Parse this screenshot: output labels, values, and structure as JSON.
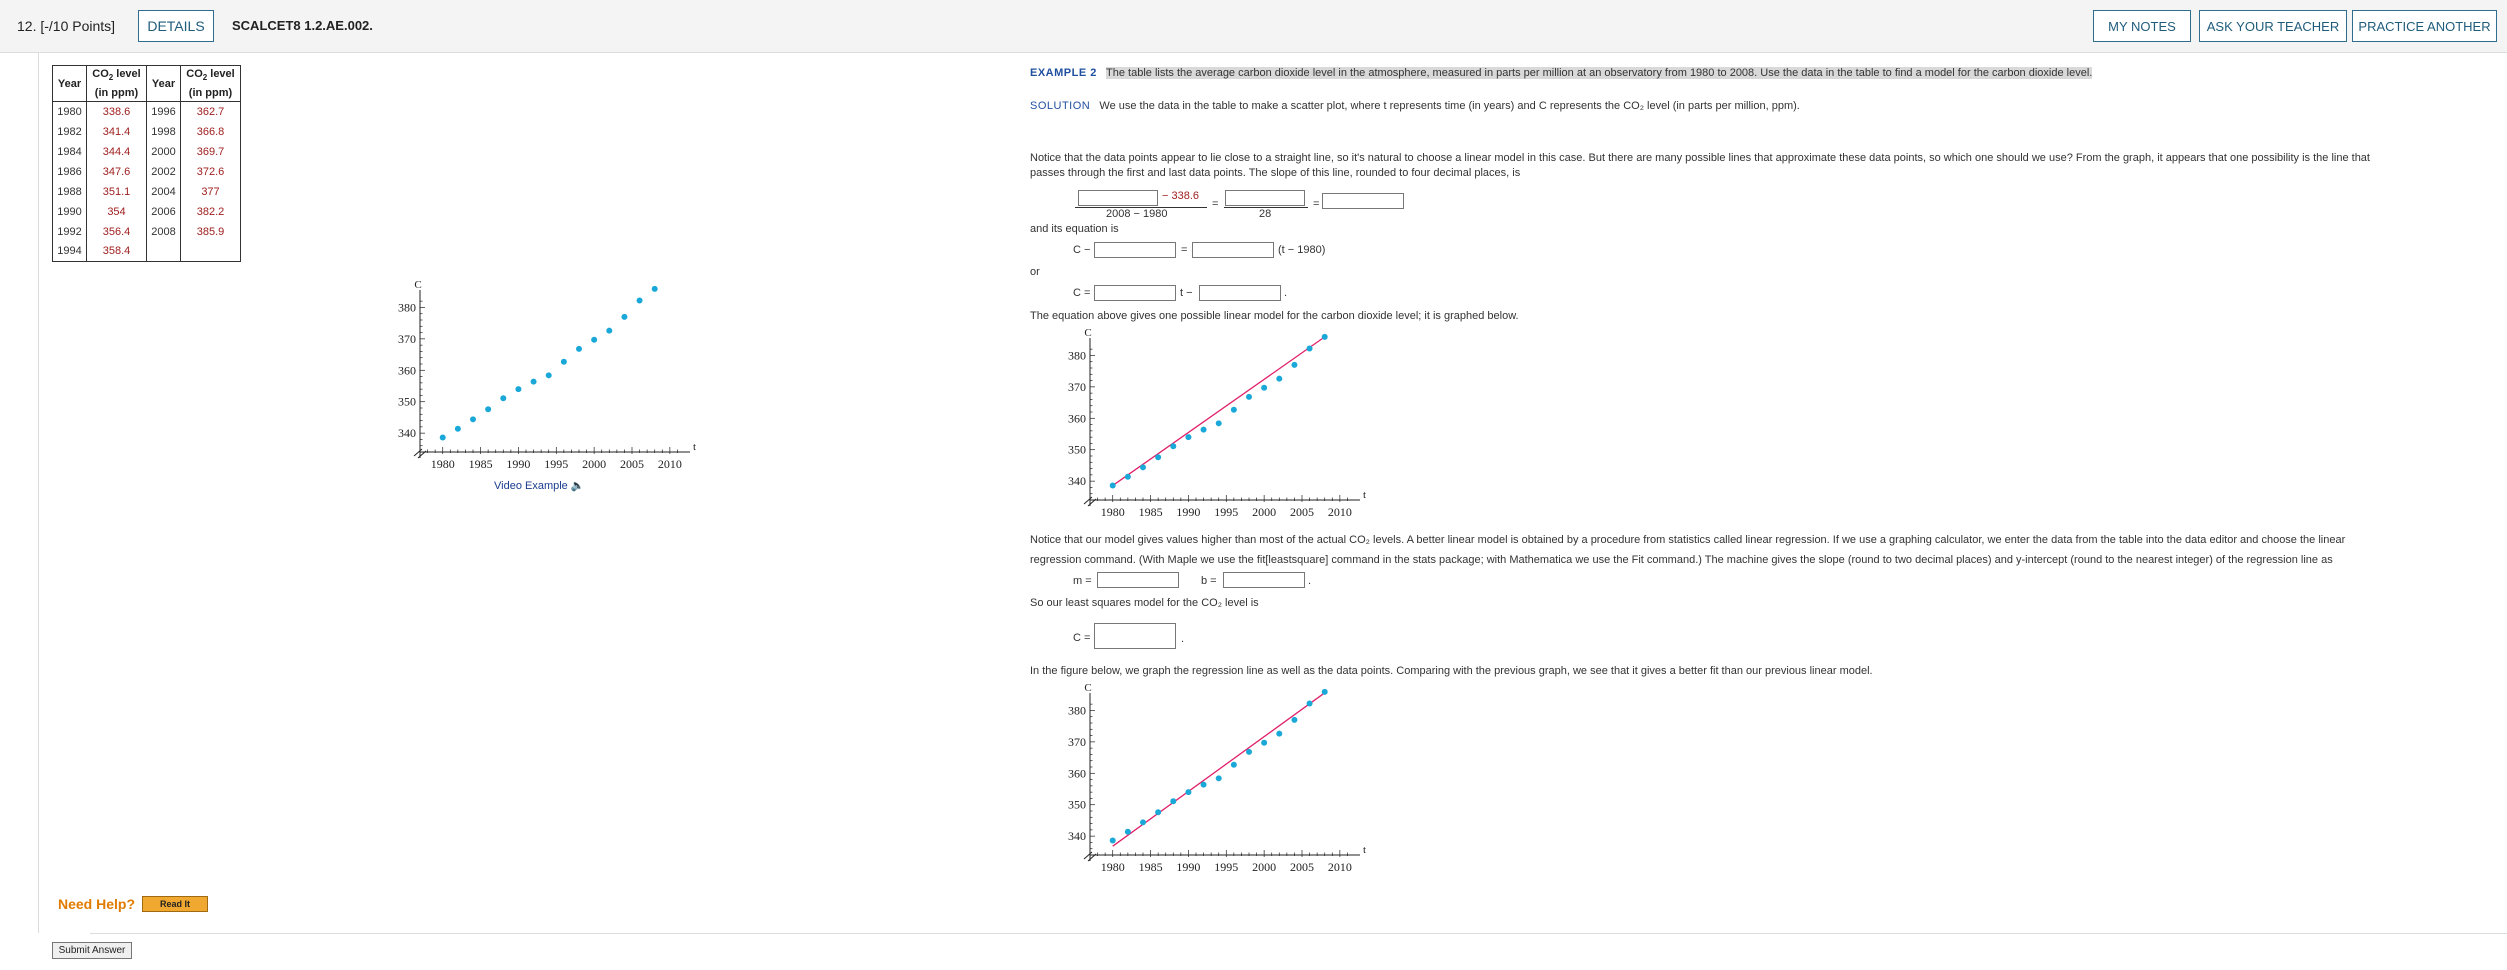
{
  "header": {
    "points": "12.  [-/10 Points]",
    "details": "DETAILS",
    "code": "SCALCET8 1.2.AE.002.",
    "my_notes": "MY NOTES",
    "ask_teacher": "ASK YOUR TEACHER",
    "practice": "PRACTICE ANOTHER"
  },
  "table": {
    "col_year": "Year",
    "col_co2_a": "CO",
    "col_co2_sub": "2",
    "col_co2_b": " level",
    "col_co2_unit": "(in ppm)",
    "rows": [
      [
        "1980",
        "338.6",
        "1996",
        "362.7"
      ],
      [
        "1982",
        "341.4",
        "1998",
        "366.8"
      ],
      [
        "1984",
        "344.4",
        "2000",
        "369.7"
      ],
      [
        "1986",
        "347.6",
        "2002",
        "372.6"
      ],
      [
        "1988",
        "351.1",
        "2004",
        "377"
      ],
      [
        "1990",
        "354",
        "2006",
        "382.2"
      ],
      [
        "1992",
        "356.4",
        "2008",
        "385.9"
      ],
      [
        "1994",
        "358.4",
        "",
        ""
      ]
    ]
  },
  "video_link": "Video Example",
  "example": {
    "label": "EXAMPLE 2",
    "intro": "The table lists the average carbon dioxide level in the atmosphere, measured in parts per million at an observatory from 1980 to 2008. Use the data in the table to find a model for the carbon dioxide level.",
    "solution_label": "SOLUTION",
    "solution_text": "We use the data in the table to make a scatter plot, where t represents time (in years) and C represents the CO₂ level (in parts per million, ppm).",
    "notice1_a": "Notice that the data points appear to lie close to a straight line, so it's natural to choose a linear model in this case. But there are many possible lines that approximate these data points, so which one should we use? From the graph, it appears that one possibility is the line that",
    "notice1_b": "passes through the first and last data points. The slope of this line, rounded to four decimal places, is",
    "minus_val": "− 338.6",
    "eq_sign": "=",
    "denom1": "2008 − 1980",
    "denom2": "28",
    "and_eq": "and its equation is",
    "c_minus": "C −",
    "t_minus_1980": "(t − 1980)",
    "or": "or",
    "c_eq": "C =",
    "t_minus": "t −",
    "period": ".",
    "graphed": "The equation above gives one possible linear model for the carbon dioxide level; it is graphed below.",
    "notice2_a": "Notice that our model gives values higher than most of the actual CO₂ levels. A better linear model is obtained by a procedure from statistics called linear regression. If we use a graphing calculator, we enter the data from the table into the data editor and choose the linear",
    "notice2_b": "regression command. (With Maple we use the fit[leastsquare] command in the stats package; with Mathematica we use the Fit command.) The machine gives the slope (round to two decimal places) and y-intercept (round to the nearest integer) of the regression line as",
    "m_eq": "m =",
    "b_eq": "b =",
    "least_sq": "So our least squares model for the CO₂ level is",
    "figure_text": "In the figure below, we graph the regression line as well as the data points. Comparing with the previous graph, we see that it gives a better fit than our previous linear model."
  },
  "footer": {
    "need_help": "Need Help?",
    "read_it": "Read It",
    "submit": "Submit Answer"
  },
  "chart_data": [
    {
      "type": "scatter",
      "xlabel": "t",
      "ylabel": "C",
      "xticks": [
        "1980",
        "1985",
        "1990",
        "1995",
        "2000",
        "2005",
        "2010"
      ],
      "yticks": [
        "340",
        "350",
        "360",
        "370",
        "380"
      ],
      "xlim": [
        1977,
        2012
      ],
      "ylim": [
        334,
        383
      ],
      "x": [
        1980,
        1982,
        1984,
        1986,
        1988,
        1990,
        1992,
        1994,
        1996,
        1998,
        2000,
        2002,
        2004,
        2006,
        2008
      ],
      "y": [
        338.6,
        341.4,
        344.4,
        347.6,
        351.1,
        354,
        356.4,
        358.4,
        362.7,
        366.8,
        369.7,
        372.6,
        377,
        382.2,
        385.9
      ],
      "point_color": "#1aa8d8"
    },
    {
      "type": "scatter",
      "xlabel": "t",
      "ylabel": "C",
      "xticks": [
        "1980",
        "1985",
        "1990",
        "1995",
        "2000",
        "2005",
        "2010"
      ],
      "yticks": [
        "340",
        "350",
        "360",
        "370",
        "380"
      ],
      "xlim": [
        1977,
        2012
      ],
      "ylim": [
        334,
        383
      ],
      "x": [
        1980,
        1982,
        1984,
        1986,
        1988,
        1990,
        1992,
        1994,
        1996,
        1998,
        2000,
        2002,
        2004,
        2006,
        2008
      ],
      "y": [
        338.6,
        341.4,
        344.4,
        347.6,
        351.1,
        354,
        356.4,
        358.4,
        362.7,
        366.8,
        369.7,
        372.6,
        377,
        382.2,
        385.9
      ],
      "point_color": "#1aa8d8",
      "line": {
        "x": [
          1980,
          2008
        ],
        "y": [
          338.6,
          385.9
        ],
        "color": "#e0206a"
      }
    },
    {
      "type": "scatter",
      "xlabel": "t",
      "ylabel": "C",
      "xticks": [
        "1980",
        "1985",
        "1990",
        "1995",
        "2000",
        "2005",
        "2010"
      ],
      "yticks": [
        "340",
        "350",
        "360",
        "370",
        "380"
      ],
      "xlim": [
        1977,
        2012
      ],
      "ylim": [
        334,
        383
      ],
      "x": [
        1980,
        1982,
        1984,
        1986,
        1988,
        1990,
        1992,
        1994,
        1996,
        1998,
        2000,
        2002,
        2004,
        2006,
        2008
      ],
      "y": [
        338.6,
        341.4,
        344.4,
        347.6,
        351.1,
        354,
        356.4,
        358.4,
        362.7,
        366.8,
        369.7,
        372.6,
        377,
        382.2,
        385.9
      ],
      "point_color": "#1aa8d8",
      "line": {
        "x": [
          1980,
          2008
        ],
        "y": [
          336.8,
          385.6
        ],
        "color": "#e0206a"
      }
    }
  ]
}
